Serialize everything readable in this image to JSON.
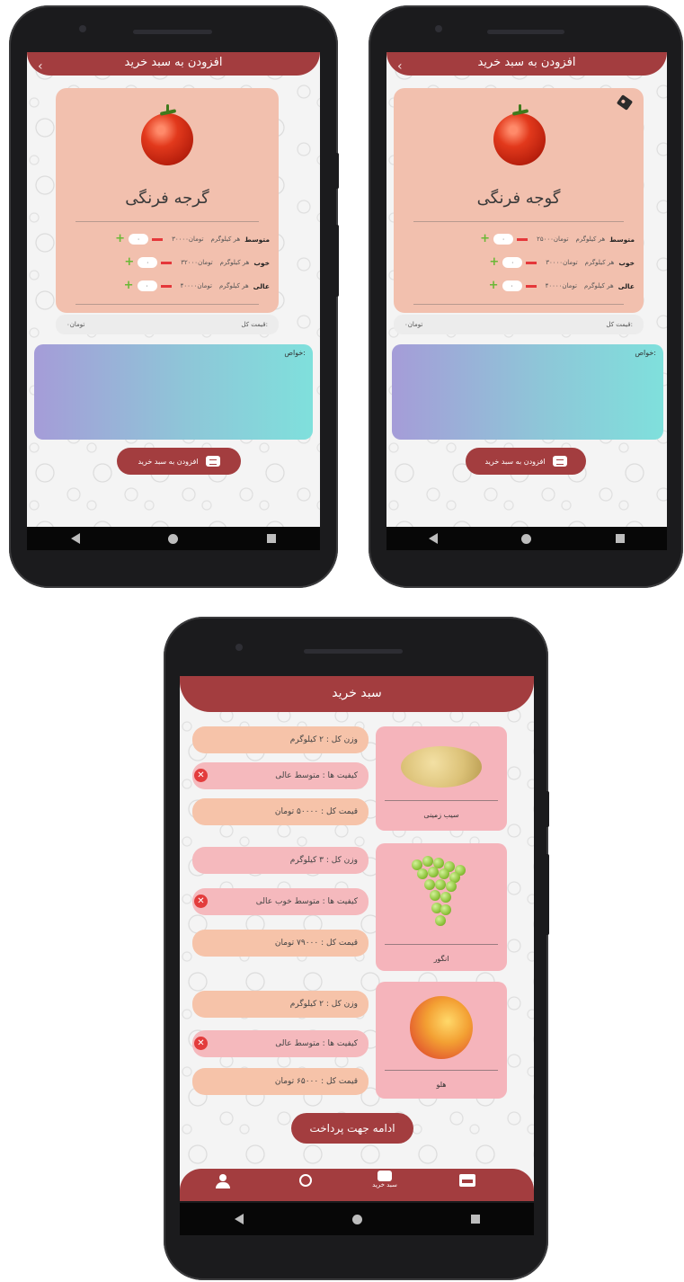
{
  "screen1": {
    "header_title": "افزودن به سبد خرید",
    "back": "‹",
    "product_title": "گرجه فرنگی",
    "rows": [
      {
        "quality": "متوسط",
        "per_kg": "هر کیلوگرم",
        "price": "۳۰۰۰۰تومان",
        "count": "۰"
      },
      {
        "quality": "خوب",
        "per_kg": "هر کیلوگرم",
        "price": "۳۲۰۰۰تومان",
        "count": "۰"
      },
      {
        "quality": "عالی",
        "per_kg": "هر کیلوگرم",
        "price": "۴۰۰۰۰تومان",
        "count": "۰"
      }
    ],
    "total_label": "قیمت کل:",
    "total_value": "۰تومان",
    "props_label": "خواص:",
    "add_button": "افزودن به سبد خرید"
  },
  "screen2": {
    "header_title": "افزودن به سبد خرید",
    "back": "‹",
    "product_title": "گوجه فرنگی",
    "rows": [
      {
        "quality": "متوسط",
        "per_kg": "هر کیلوگرم",
        "price": "۲۵۰۰۰تومان",
        "count": "۰"
      },
      {
        "quality": "خوب",
        "per_kg": "هر کیلوگرم",
        "price": "۳۰۰۰۰تومان",
        "count": "۰"
      },
      {
        "quality": "عالی",
        "per_kg": "هر کیلوگرم",
        "price": "۴۰۰۰۰تومان",
        "count": "۰"
      }
    ],
    "total_label": "قیمت کل:",
    "total_value": "۰تومان",
    "props_label": "خواص:",
    "add_button": "افزودن به سبد خرید"
  },
  "cart": {
    "header_title": "سبد خرید",
    "items": [
      {
        "name": "سیب زمینی",
        "weight": "وزن کل : ۲ کیلوگرم",
        "qualities": "کیفیت ها : متوسط  عالی",
        "total": "قیمت کل : ۵۰۰۰۰ تومان"
      },
      {
        "name": "انگور",
        "weight": "وزن کل : ۳ کیلوگرم",
        "qualities": "کیفیت ها : متوسط  خوب  عالی",
        "total": "قیمت کل : ۷۹۰۰۰ تومان"
      },
      {
        "name": "هلو",
        "weight": "وزن کل : ۲ کیلوگرم",
        "qualities": "کیفیت ها : متوسط  عالی",
        "total": "قیمت کل : ۶۵۰۰۰ تومان"
      }
    ],
    "remove": "✕",
    "continue_button": "ادامه جهت پرداخت",
    "tab_cart_label": "سبد خرید"
  },
  "colors": {
    "primary": "#a33d3f",
    "card": "#f2c0ae",
    "pink": "#f5b4bb",
    "peach_pill": "#f6c3a9"
  }
}
